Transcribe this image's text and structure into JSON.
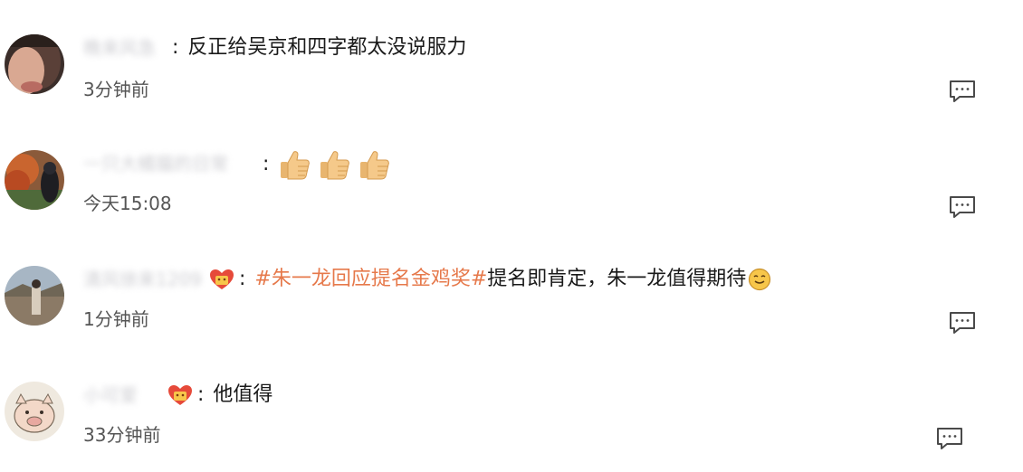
{
  "comments": [
    {
      "username": "晚来风急",
      "text": "反正给吴京和四字都太没说服力",
      "time": "3分钟前"
    },
    {
      "username": "一只大橘猫的日常",
      "text": "",
      "reaction_icons": [
        "thumbs-up-icon",
        "thumbs-up-icon",
        "thumbs-up-icon"
      ],
      "time": "今天15:08"
    },
    {
      "username": "清风徐来1209",
      "hashtag": "#朱一龙回应提名金鸡奖#",
      "text": " 提名即肯定，朱一龙值得期待",
      "time": "1分钟前"
    },
    {
      "username": "小可爱",
      "text": "他值得",
      "time": "33分钟前"
    }
  ],
  "colors": {
    "hashtag": "#e6794b",
    "time": "#555555",
    "text": "#1a1a1a",
    "icon_stroke": "#4a4a4a"
  }
}
